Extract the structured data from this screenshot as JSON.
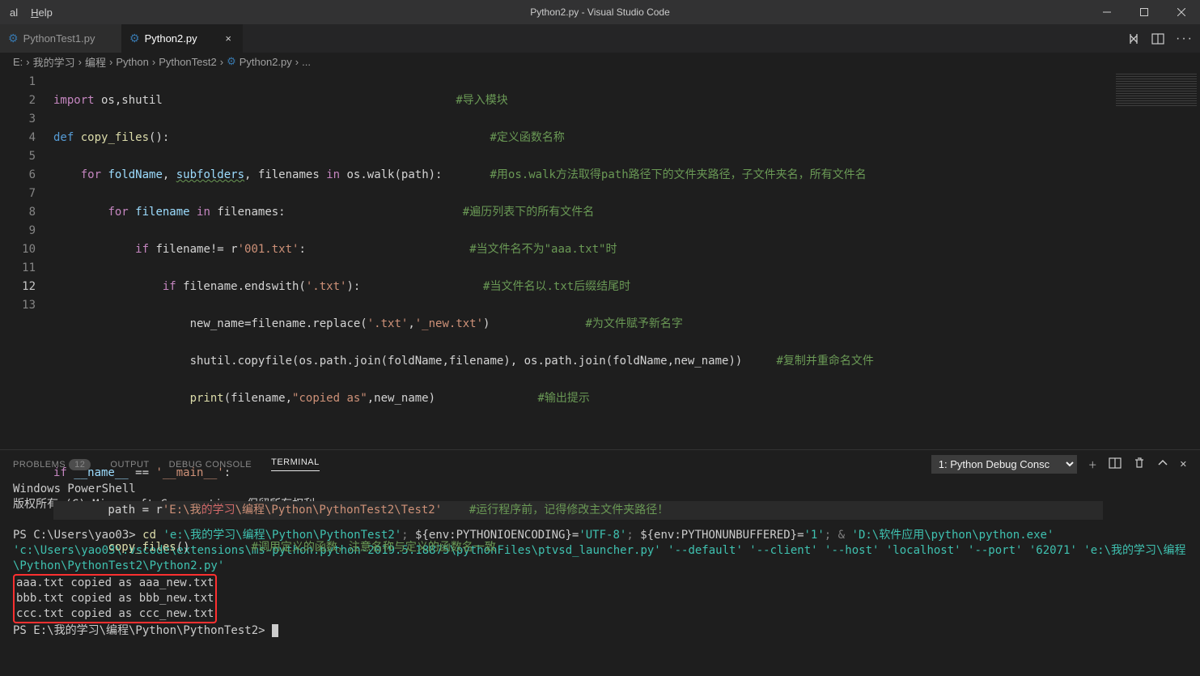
{
  "window": {
    "title": "Python2.py - Visual Studio Code",
    "menu": {
      "item1": "al",
      "item2": "Help"
    }
  },
  "tabs": {
    "tab1": {
      "label": "PythonTest1.py"
    },
    "tab2": {
      "label": "Python2.py"
    }
  },
  "breadcrumbs": {
    "b0": "E:",
    "b1": "我的学习",
    "b2": "编程",
    "b3": "Python",
    "b4": "PythonTest2",
    "b5": "Python2.py",
    "b6": "..."
  },
  "code": {
    "ln1": "1",
    "ln2": "2",
    "ln3": "3",
    "ln4": "4",
    "ln5": "5",
    "ln6": "6",
    "ln7": "7",
    "ln8": "8",
    "ln9": "9",
    "ln10": "10",
    "ln11": "11",
    "ln12": "12",
    "ln13": "13",
    "l1": {
      "kw": "import",
      "rest": " os,shutil",
      "cmt": "#导入模块"
    },
    "l2": {
      "kw": "def",
      "fn": " copy_files",
      "paren": "():",
      "cmt": "#定义函数名称"
    },
    "l3": {
      "kw1": "for",
      "v1": " foldName",
      "comma": ", ",
      "v2": "subfolders",
      "comma2": ", filenames ",
      "kw2": "in",
      "rest": " os.walk(path):",
      "cmt": "#用os.walk方法取得path路径下的文件夹路径，子文件夹名，所有文件名"
    },
    "l4": {
      "kw1": "for",
      "v1": " filename ",
      "kw2": "in",
      "rest": " filenames:",
      "cmt": "#遍历列表下的所有文件名"
    },
    "l5": {
      "kw": "if",
      "rest1": " filename!= r",
      "str": "'001.txt'",
      "colon": ":",
      "cmt": "#当文件名不为\"aaa.txt\"时"
    },
    "l6": {
      "kw": "if",
      "rest1": " filename.endswith(",
      "str": "'.txt'",
      "rest2": "):",
      "cmt": "#当文件名以.txt后缀结尾时"
    },
    "l7": {
      "rest1": "new_name=filename.replace(",
      "str1": "'.txt'",
      "comma": ",",
      "str2": "'_new.txt'",
      "rest2": ")",
      "cmt": "#为文件赋予新名字"
    },
    "l8": {
      "rest1": "shutil.copyfile(os.path.join(foldName,filename), os.path.join(foldName,new_name))",
      "cmt": "#复制并重命名文件"
    },
    "l9": {
      "fn": "print",
      "rest1": "(filename,",
      "str": "\"copied as\"",
      "rest2": ",new_name)",
      "cmt": "#输出提示"
    },
    "l11": {
      "kw": "if",
      "name1": " __name__ ",
      "eq": "==",
      "str": " '__main__'",
      "colon": ":"
    },
    "l12": {
      "var": "path = r",
      "str": "'E:\\我",
      "pink": "的学习",
      "str2": "\\编程\\Python\\PythonTest2\\Test2'",
      "cmt": "#运行程序前，记得修改主文件夹路径！"
    },
    "l13": {
      "fn": "copy_files",
      "paren": "()",
      "cmt": "#调用定义的函数，注意名称与定义的函数名一致"
    }
  },
  "panel": {
    "problems": "PROBLEMS",
    "problems_count": "12",
    "output": "OUTPUT",
    "debug": "DEBUG CONSOLE",
    "terminal": "TERMINAL",
    "select": "1: Python Debug Consc"
  },
  "terminal": {
    "l1": "Windows PowerShell",
    "l2": "版权所有 (C) Microsoft Corporation。保留所有权利。",
    "prompt1": "PS C:\\Users\\yao03> ",
    "cmd": "cd ",
    "path1": "'e:\\我的学习\\编程\\Python\\PythonTest2'",
    "sep1": "; ",
    "env1": "${env:PYTHONIOENCODING}=",
    "env1v": "'UTF-8'",
    "sep2": "; ",
    "env2": "${env:PYTHONUNBUFFERED}=",
    "env2v": "'1'",
    "sep3": "; & ",
    "exe": "'D:\\软件应用\\python\\python.exe'",
    "cont1": " 'c:\\Users\\yao03\\.vscode\\extensions\\ms-python.python-2019.5.18875\\pythonFiles\\ptvsd_launcher.py' '--default' '--client' '--host' 'localhost' '--port' '62071' 'e:\\我的学习\\编程\\Python\\PythonTest2\\Python2.py'",
    "out1": "aaa.txt copied as aaa_new.txt",
    "out2": "bbb.txt copied as bbb_new.txt",
    "out3": "ccc.txt copied as ccc_new.txt",
    "prompt2": "PS E:\\我的学习\\编程\\Python\\PythonTest2> "
  }
}
